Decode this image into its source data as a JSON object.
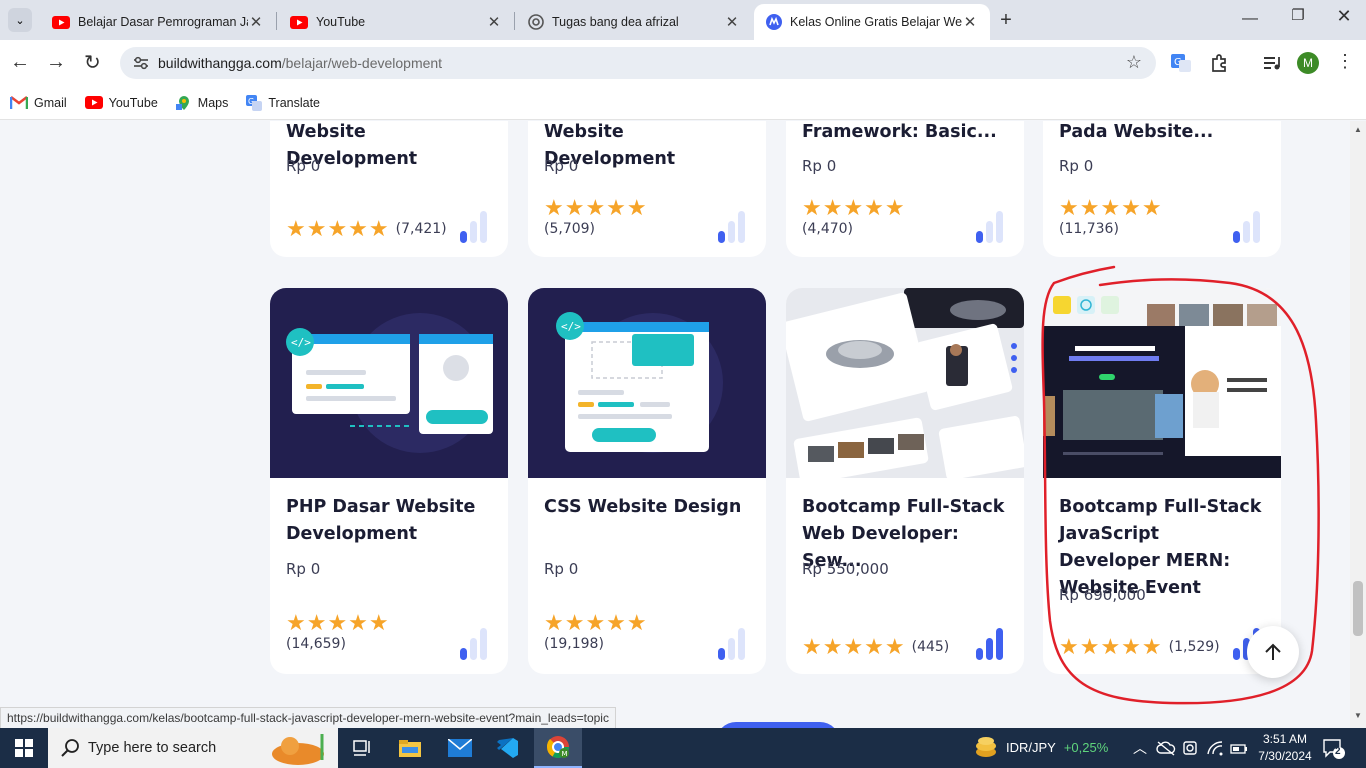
{
  "browser": {
    "tabs": [
      {
        "title": "Belajar Dasar Pemrograman Jav",
        "icon": "youtube-icon"
      },
      {
        "title": "YouTube",
        "icon": "youtube-icon"
      },
      {
        "title": "Tugas bang dea afrizal",
        "icon": "globe-icon"
      },
      {
        "title": "Kelas Online Gratis Belajar Web",
        "icon": "bwa-icon",
        "active": true
      }
    ],
    "address": {
      "domain": "buildwithangga.com",
      "path": "/belajar/web-development"
    },
    "bookmarks": [
      "Gmail",
      "YouTube",
      "Maps",
      "Translate"
    ],
    "profile_initial": "M"
  },
  "top_row_cards": [
    {
      "title": "Website Development",
      "price": "Rp 0",
      "rating_count": "(7,421)",
      "level": 1
    },
    {
      "title": "Website Development",
      "price": "Rp 0",
      "rating_count": "(5,709)",
      "level": 1
    },
    {
      "title": "Framework: Basic...",
      "price": "Rp 0",
      "rating_count": "(4,470)",
      "level": 1
    },
    {
      "title": "Pada Website...",
      "price": "Rp 0",
      "rating_count": "(11,736)",
      "level": 1
    }
  ],
  "cards": [
    {
      "title": "PHP Dasar Website Development",
      "price": "Rp 0",
      "rating_count": "(14,659)",
      "level": 1
    },
    {
      "title": "CSS Website Design",
      "price": "Rp 0",
      "rating_count": "(19,198)",
      "level": 1
    },
    {
      "title": "Bootcamp Full-Stack Web Developer: Sew...",
      "price": "Rp 550,000",
      "rating_count": "(445)",
      "level": 3
    },
    {
      "title": "Bootcamp Full-Stack JavaScript Developer MERN: Website Event",
      "price": "Rp 690,000",
      "rating_count": "(1,529)",
      "level": 3
    }
  ],
  "stars": "★★★★★",
  "status_url": "https://buildwithangga.com/kelas/bootcamp-full-stack-javascript-developer-mern-website-event?main_leads=topic",
  "taskbar": {
    "search_placeholder": "Type here to search",
    "ticker": {
      "pair": "IDR/JPY",
      "change": "+0,25%"
    },
    "time": "3:51 AM",
    "date": "7/30/2024",
    "notifications": "2"
  },
  "colors": {
    "accent": "#3f60f0",
    "star": "#f6a429",
    "annotation": "#e0202a",
    "ticker_up": "#5fd47c"
  }
}
